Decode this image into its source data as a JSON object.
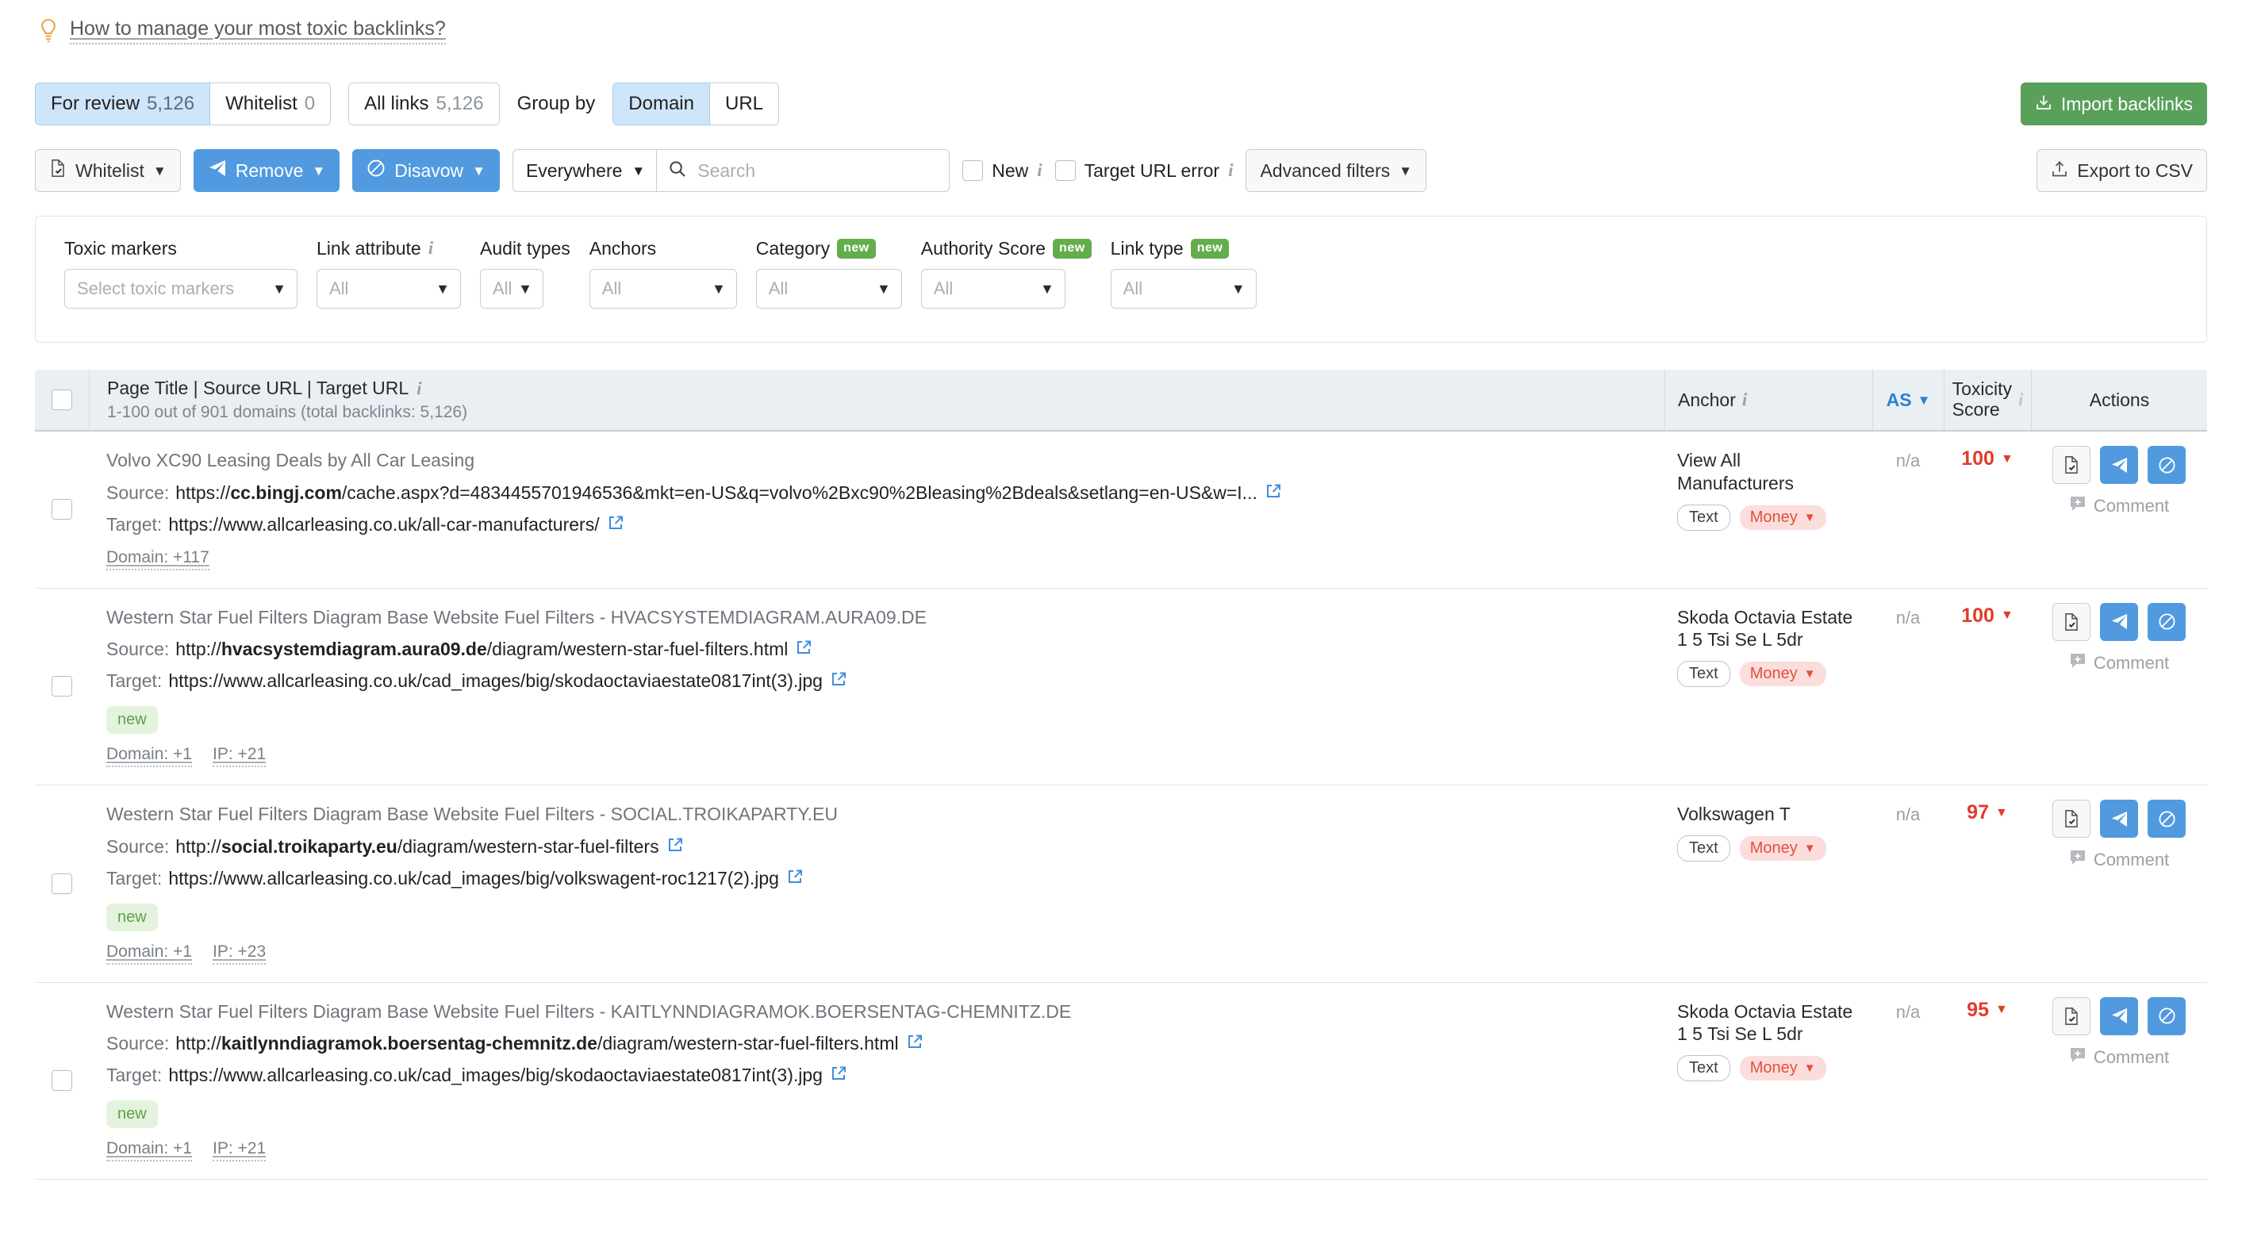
{
  "tip": {
    "text": "How to manage your most toxic backlinks?",
    "icon": "lightbulb-icon"
  },
  "tabs": {
    "for_review_label": "For review",
    "for_review_count": "5,126",
    "whitelist_label": "Whitelist",
    "whitelist_count": "0",
    "all_links_label": "All links",
    "all_links_count": "5,126",
    "group_by_label": "Group by",
    "group_domain": "Domain",
    "group_url": "URL"
  },
  "toolbar": {
    "whitelist": "Whitelist",
    "remove": "Remove",
    "disavow": "Disavow",
    "scope": "Everywhere",
    "search_placeholder": "Search",
    "search_value": "",
    "new_label": "New",
    "target_url_error_label": "Target URL error",
    "advanced_filters": "Advanced filters",
    "import_backlinks": "Import backlinks",
    "export_csv": "Export to CSV"
  },
  "filters": [
    {
      "label": "Toxic markers",
      "value": "Select toxic markers",
      "info": false,
      "new": false,
      "width": "w-toxic"
    },
    {
      "label": "Link attribute",
      "value": "All",
      "info": true,
      "new": false,
      "width": "w-linkattr"
    },
    {
      "label": "Audit types",
      "value": "All",
      "info": false,
      "new": false,
      "width": "w-audit"
    },
    {
      "label": "Anchors",
      "value": "All",
      "info": false,
      "new": false,
      "width": "w-anchors"
    },
    {
      "label": "Category",
      "value": "All",
      "info": false,
      "new": true,
      "width": "w-category"
    },
    {
      "label": "Authority Score",
      "value": "All",
      "info": false,
      "new": true,
      "width": "w-authority"
    },
    {
      "label": "Link type",
      "value": "All",
      "info": false,
      "new": true,
      "width": "w-linktype"
    }
  ],
  "badge_new_text": "new",
  "table": {
    "header": {
      "main": "Page Title | Source URL | Target URL",
      "sub": "1-100 out of 901 domains (total backlinks: 5,126)",
      "anchor": "Anchor",
      "as": "AS",
      "toxicity": "Toxicity\nScore",
      "toxicity_line1": "Toxicity",
      "toxicity_line2": "Score",
      "actions": "Actions"
    },
    "source_label": "Source:",
    "target_label": "Target:",
    "comment_label": "Comment",
    "tag_text_label": "Text",
    "tag_money_label": "Money",
    "new_pill": "new",
    "rows": [
      {
        "title": "Volvo XC90 Leasing Deals by All Car Leasing",
        "source_scheme": "https://",
        "source_domain": "cc.bingj.com",
        "source_path": "/cache.aspx?d=4834455701946536&mkt=en-US&q=volvo%2Bxc90%2Bleasing%2Bdeals&setlang=en-US&w=I...",
        "target_url": "https://www.allcarleasing.co.uk/all-car-manufacturers/",
        "is_new": false,
        "meta": [
          "Domain: +117"
        ],
        "anchor": "View All Manufacturers",
        "as": "n/a",
        "toxicity": "100"
      },
      {
        "title": "Western Star Fuel Filters Diagram Base Website Fuel Filters - HVACSYSTEMDIAGRAM.AURA09.DE",
        "source_scheme": "http://",
        "source_domain": "hvacsystemdiagram.aura09.de",
        "source_path": "/diagram/western-star-fuel-filters.html",
        "target_url": "https://www.allcarleasing.co.uk/cad_images/big/skodaoctaviaestate0817int(3).jpg",
        "is_new": true,
        "meta": [
          "Domain: +1",
          "IP: +21"
        ],
        "anchor": "Skoda Octavia Estate 1 5 Tsi Se L 5dr",
        "as": "n/a",
        "toxicity": "100"
      },
      {
        "title": "Western Star Fuel Filters Diagram Base Website Fuel Filters - SOCIAL.TROIKAPARTY.EU",
        "source_scheme": "http://",
        "source_domain": "social.troikaparty.eu",
        "source_path": "/diagram/western-star-fuel-filters",
        "target_url": "https://www.allcarleasing.co.uk/cad_images/big/volkswagent-roc1217(2).jpg",
        "is_new": true,
        "meta": [
          "Domain: +1",
          "IP: +23"
        ],
        "anchor": "Volkswagen T",
        "as": "n/a",
        "toxicity": "97"
      },
      {
        "title": "Western Star Fuel Filters Diagram Base Website Fuel Filters - KAITLYNNDIAGRAMOK.BOERSENTAG-CHEMNITZ.DE",
        "source_scheme": "http://",
        "source_domain": "kaitlynndiagramok.boersentag-chemnitz.de",
        "source_path": "/diagram/western-star-fuel-filters.html",
        "target_url": "https://www.allcarleasing.co.uk/cad_images/big/skodaoctaviaestate0817int(3).jpg",
        "is_new": true,
        "meta": [
          "Domain: +1",
          "IP: +21"
        ],
        "anchor": "Skoda Octavia Estate 1 5 Tsi Se L 5dr",
        "as": "n/a",
        "toxicity": "95"
      }
    ]
  },
  "colors": {
    "primary_blue": "#519ae0",
    "green": "#59a05a",
    "toxic_red": "#e23c2a",
    "tab_active": "#cfe5f9",
    "header_bg": "#e9eff3",
    "new_badge": "#64ad4c"
  }
}
